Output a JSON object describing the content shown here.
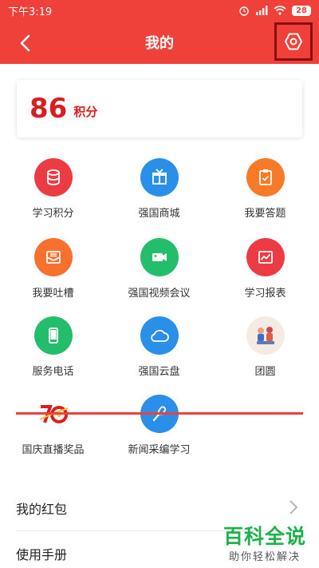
{
  "status_bar": {
    "time": "下午3:19",
    "battery": "28"
  },
  "nav": {
    "title": "我的"
  },
  "points": {
    "value": "86",
    "unit": "积分"
  },
  "grid": [
    {
      "label": "学习积分",
      "icon": "database-icon",
      "color": "#ec3b42"
    },
    {
      "label": "强国商城",
      "icon": "gift-icon",
      "color": "#2a8fe8"
    },
    {
      "label": "我要答题",
      "icon": "clipboard-icon",
      "color": "#f77a28"
    },
    {
      "label": "我要吐槽",
      "icon": "mail-icon",
      "color": "#f7702d"
    },
    {
      "label": "强国视频会议",
      "icon": "video-camera-icon",
      "color": "#24bd6c"
    },
    {
      "label": "学习报表",
      "icon": "chart-icon",
      "color": "#ec3b42"
    },
    {
      "label": "服务电话",
      "icon": "phone-icon",
      "color": "#24bd6c"
    },
    {
      "label": "强国云盘",
      "icon": "cloud-icon",
      "color": "#2a8fe8"
    },
    {
      "label": "团圆",
      "icon": "family-illustration-icon",
      "color": "#f4ebe4"
    },
    {
      "label": "国庆直播奖品",
      "icon": "national-day-70-icon",
      "color": "#ffffff"
    },
    {
      "label": "新闻采编学习",
      "icon": "microphone-icon",
      "color": "#2a8fe8"
    }
  ],
  "list": [
    {
      "label": "我的红包"
    },
    {
      "label": "使用手册"
    }
  ],
  "watermark": {
    "main": "百科全说",
    "sub": "助你轻松解决"
  },
  "colors": {
    "header": "#f0403a",
    "points_text": "#d81e1e",
    "watermark": "#1fb14b"
  }
}
